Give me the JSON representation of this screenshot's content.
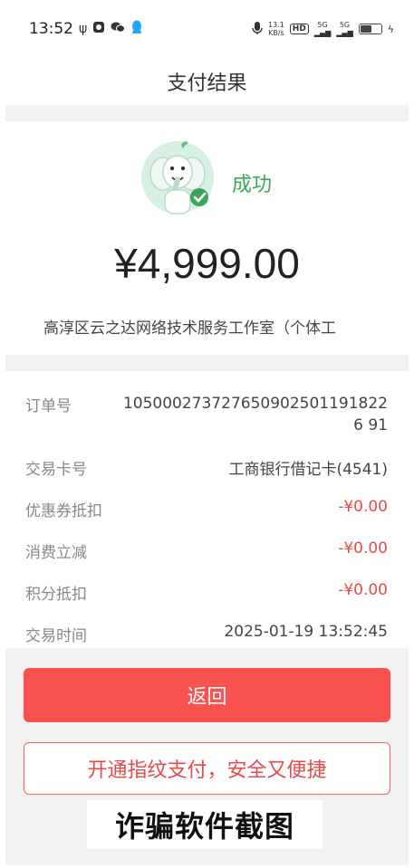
{
  "status_bar": {
    "time": "13:52",
    "net_speed_value": "13.1",
    "net_speed_unit": "KB/s",
    "hd_label": "HD",
    "signal1": "5G",
    "signal2": "5G"
  },
  "nav": {
    "title": "支付结果"
  },
  "result": {
    "status": "成功",
    "amount": "¥4,999.00",
    "merchant": "高淳区云之达网络技术服务工作室（个体工"
  },
  "details": {
    "rows": [
      {
        "label": "订单号",
        "value": "1050002737276509025011918226 91"
      },
      {
        "label": "交易卡号",
        "value": "工商银行借记卡(4541)"
      },
      {
        "label": "优惠券抵扣",
        "value": "-¥0.00"
      },
      {
        "label": "消费立减",
        "value": "-¥0.00"
      },
      {
        "label": "积分抵扣",
        "value": "-¥0.00"
      },
      {
        "label": "交易时间",
        "value": "2025-01-19 13:52:45"
      }
    ]
  },
  "actions": {
    "back_label": "返回",
    "fingerprint_label": "开通指纹支付，安全又便捷"
  },
  "overlay": {
    "watermark": "诈骗软件截图"
  },
  "colors": {
    "success": "#3aa757",
    "deduction": "#e64a4a",
    "primary_button": "#fa5151"
  },
  "icons": [
    "usb-icon",
    "record-icon",
    "wechat-icon",
    "qq-icon",
    "mic-icon",
    "battery-icon",
    "mascot-success-icon"
  ]
}
